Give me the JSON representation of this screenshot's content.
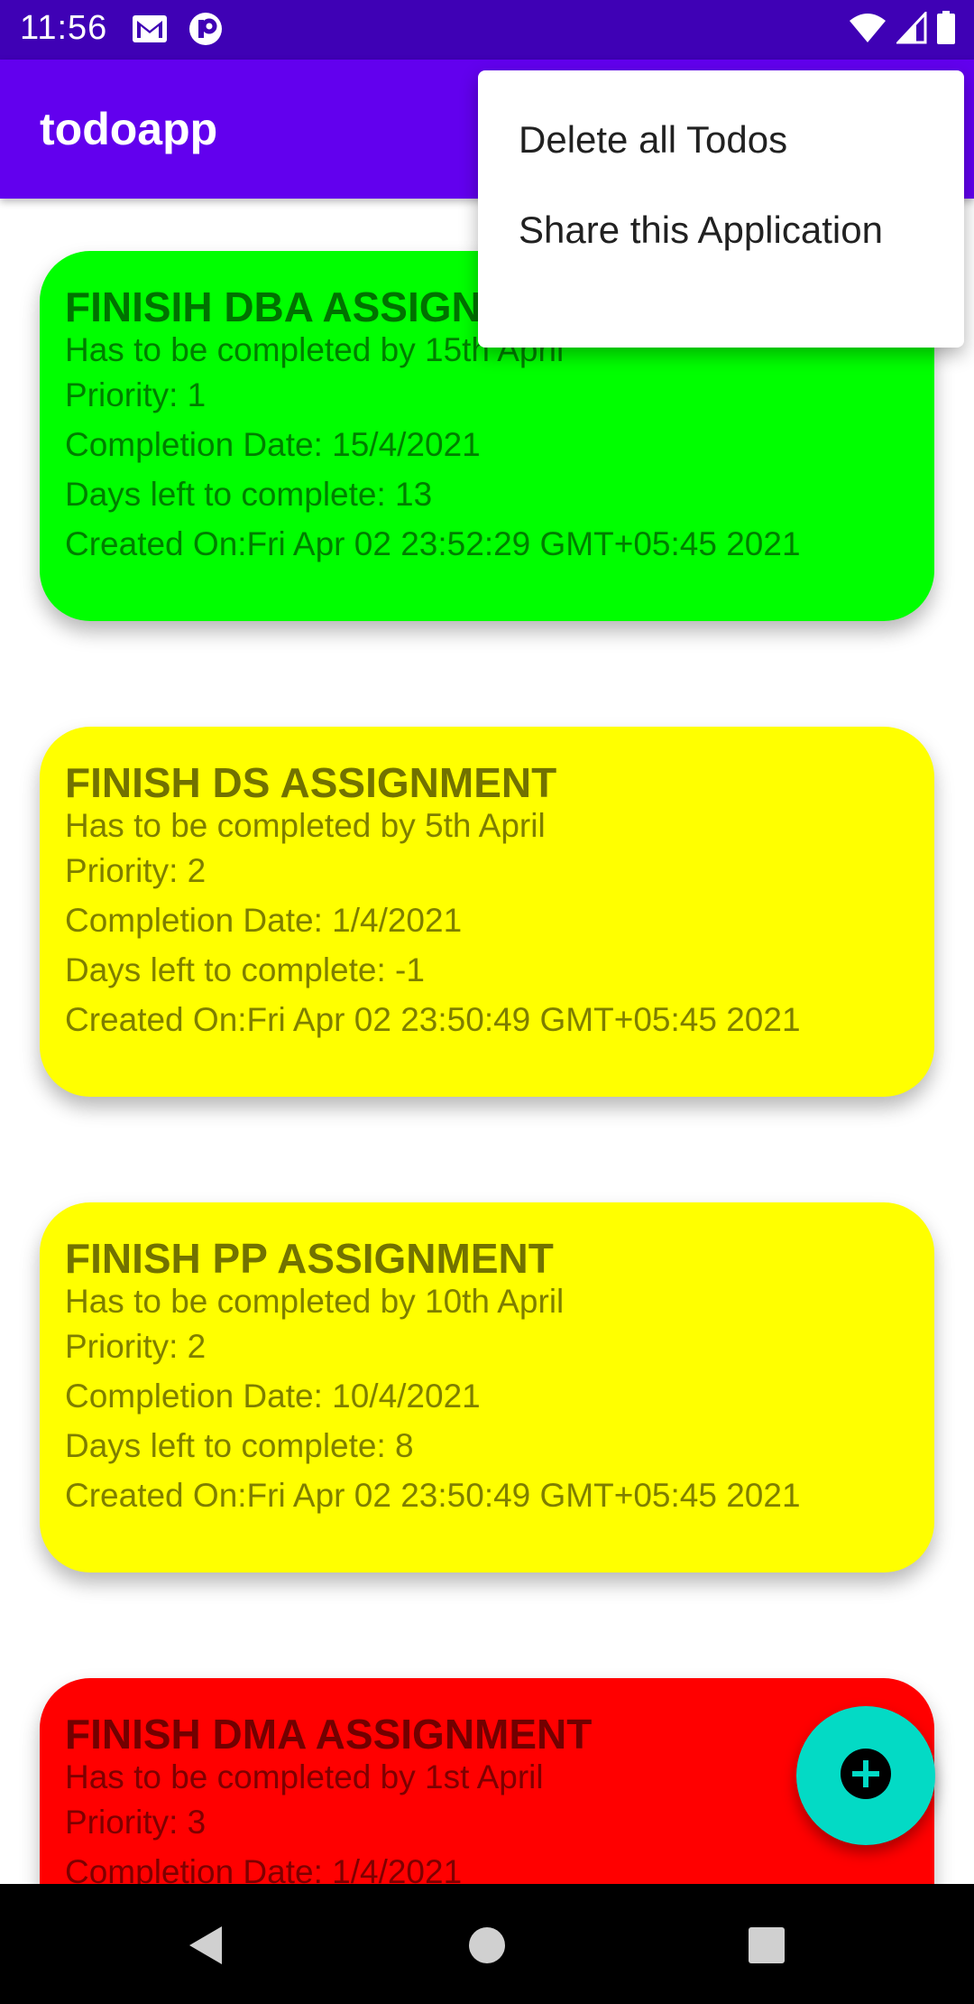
{
  "status_bar": {
    "time": "11:56",
    "icons": [
      "gmail-icon",
      "app-notification-icon",
      "wifi-icon",
      "signal-icon",
      "battery-icon"
    ]
  },
  "app_bar": {
    "title": "todoapp",
    "color": "#6200ee"
  },
  "overflow_menu": {
    "items": [
      {
        "label": "Delete all Todos"
      },
      {
        "label": "Share this Application"
      }
    ]
  },
  "todos": [
    {
      "title": "FINISIH DBA ASSIGNMENT",
      "description": "Has to be completed by 15th April",
      "priority": "Priority: 1",
      "completion_date": "Completion Date: 15/4/2021",
      "days_left": "Days left to complete: 13",
      "created_on": "Created On:Fri Apr 02 23:52:29 GMT+05:45 2021",
      "color": "#00ff00"
    },
    {
      "title": "FINISH DS ASSIGNMENT",
      "description": "Has to be completed by 5th April",
      "priority": "Priority: 2",
      "completion_date": "Completion Date: 1/4/2021",
      "days_left": "Days left to complete: -1",
      "created_on": "Created On:Fri Apr 02 23:50:49 GMT+05:45 2021",
      "color": "#ffff00"
    },
    {
      "title": "FINISH PP ASSIGNMENT",
      "description": "Has to be completed by 10th April",
      "priority": "Priority: 2",
      "completion_date": "Completion Date: 10/4/2021",
      "days_left": "Days left to complete: 8",
      "created_on": "Created On:Fri Apr 02 23:50:49 GMT+05:45 2021",
      "color": "#ffff00"
    },
    {
      "title": "FINISH DMA ASSIGNMENT",
      "description": "Has to be completed by 1st April",
      "priority": "Priority: 3",
      "completion_date": "Completion Date: 1/4/2021",
      "color": "#ff0000"
    }
  ],
  "fab": {
    "icon": "add-circle-icon",
    "color": "#03dac5"
  },
  "nav_bar": {
    "buttons": [
      "back-icon",
      "home-icon",
      "recents-icon"
    ]
  }
}
